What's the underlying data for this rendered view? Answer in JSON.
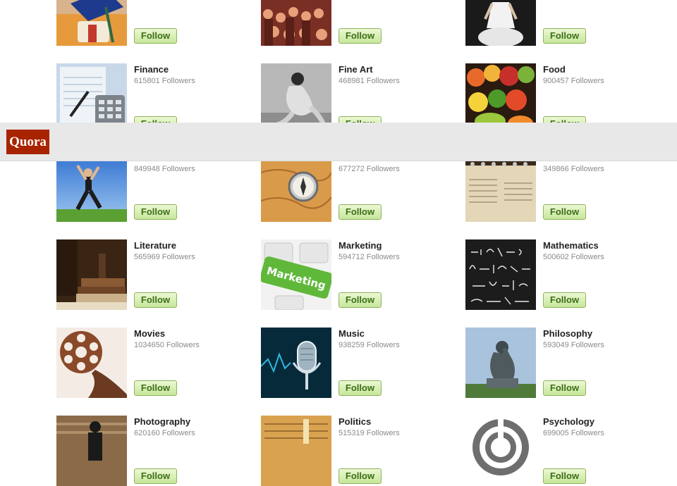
{
  "app": {
    "logo_text": "Quora",
    "brand_color": "#a82400"
  },
  "follow_button_color": "#c6e79a",
  "topics": [
    {
      "name": "",
      "followers": "",
      "icon": "graduation-image"
    },
    {
      "name": "",
      "followers": "",
      "icon": "concert-crowd-image"
    },
    {
      "name": "",
      "followers": "",
      "icon": "fashion-dress-image"
    },
    {
      "name": "Finance",
      "followers": "615801",
      "icon": "finance-calculator-image"
    },
    {
      "name": "Fine Art",
      "followers": "468981",
      "icon": "fine-art-sculpture-image"
    },
    {
      "name": "Food",
      "followers": "900457",
      "icon": "food-fruits-image"
    },
    {
      "name": "",
      "followers": "849948",
      "icon": "fitness-jump-image"
    },
    {
      "name": "",
      "followers": "677272",
      "icon": "compass-map-image"
    },
    {
      "name": "",
      "followers": "349866",
      "icon": "newspaper-notebook-image"
    },
    {
      "name": "Literature",
      "followers": "565969",
      "icon": "old-books-image"
    },
    {
      "name": "Marketing",
      "followers": "594712",
      "icon": "marketing-keyboard-image"
    },
    {
      "name": "Mathematics",
      "followers": "500602",
      "icon": "chalkboard-formulas-image"
    },
    {
      "name": "Movies",
      "followers": "1034650",
      "icon": "film-reel-image"
    },
    {
      "name": "Music",
      "followers": "938259",
      "icon": "microphone-image"
    },
    {
      "name": "Philosophy",
      "followers": "593049",
      "icon": "thinker-statue-image"
    },
    {
      "name": "Photography",
      "followers": "620160",
      "icon": "photographer-silhouette-image"
    },
    {
      "name": "Politics",
      "followers": "515319",
      "icon": "constitution-document-image"
    },
    {
      "name": "Psychology",
      "followers": "699005",
      "icon": "labyrinth-head-image"
    }
  ],
  "labels": {
    "follow": "Follow",
    "followers_suffix": "Followers"
  }
}
